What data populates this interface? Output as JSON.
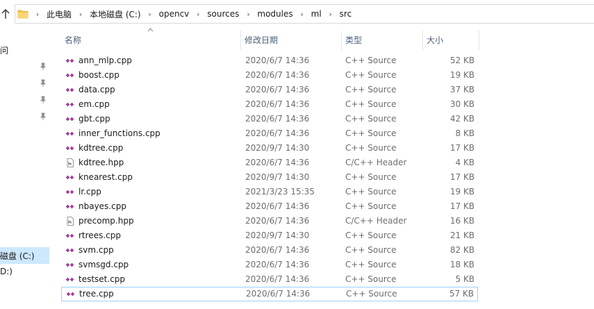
{
  "address": {
    "crumbs": [
      "此电脑",
      "本地磁盘 (C:)",
      "opencv",
      "sources",
      "modules",
      "ml",
      "src"
    ],
    "separator": "›"
  },
  "nav": {
    "partial_top": "问",
    "drive_c": "磁盘 (C:)",
    "drive_d": "D:)"
  },
  "columns": {
    "name": "名称",
    "date": "修改日期",
    "type": "类型",
    "size": "大小"
  },
  "files": [
    {
      "name": "ann_mlp.cpp",
      "date": "2020/6/7 14:36",
      "type": "C++ Source",
      "size": "52 KB",
      "icon": "cpp-file-icon"
    },
    {
      "name": "boost.cpp",
      "date": "2020/6/7 14:36",
      "type": "C++ Source",
      "size": "19 KB",
      "icon": "cpp-file-icon"
    },
    {
      "name": "data.cpp",
      "date": "2020/6/7 14:36",
      "type": "C++ Source",
      "size": "37 KB",
      "icon": "cpp-file-icon"
    },
    {
      "name": "em.cpp",
      "date": "2020/6/7 14:36",
      "type": "C++ Source",
      "size": "30 KB",
      "icon": "cpp-file-icon"
    },
    {
      "name": "gbt.cpp",
      "date": "2020/6/7 14:36",
      "type": "C++ Source",
      "size": "42 KB",
      "icon": "cpp-file-icon"
    },
    {
      "name": "inner_functions.cpp",
      "date": "2020/6/7 14:36",
      "type": "C++ Source",
      "size": "8 KB",
      "icon": "cpp-file-icon"
    },
    {
      "name": "kdtree.cpp",
      "date": "2020/9/7 14:30",
      "type": "C++ Source",
      "size": "17 KB",
      "icon": "cpp-file-icon"
    },
    {
      "name": "kdtree.hpp",
      "date": "2020/6/7 14:36",
      "type": "C/C++ Header",
      "size": "4 KB",
      "icon": "header-file-icon"
    },
    {
      "name": "knearest.cpp",
      "date": "2020/9/7 14:30",
      "type": "C++ Source",
      "size": "17 KB",
      "icon": "cpp-file-icon"
    },
    {
      "name": "lr.cpp",
      "date": "2021/3/23 15:35",
      "type": "C++ Source",
      "size": "19 KB",
      "icon": "cpp-file-icon"
    },
    {
      "name": "nbayes.cpp",
      "date": "2020/6/7 14:36",
      "type": "C++ Source",
      "size": "17 KB",
      "icon": "cpp-file-icon"
    },
    {
      "name": "precomp.hpp",
      "date": "2020/6/7 14:36",
      "type": "C/C++ Header",
      "size": "16 KB",
      "icon": "header-file-icon"
    },
    {
      "name": "rtrees.cpp",
      "date": "2020/9/7 14:30",
      "type": "C++ Source",
      "size": "21 KB",
      "icon": "cpp-file-icon"
    },
    {
      "name": "svm.cpp",
      "date": "2020/6/7 14:36",
      "type": "C++ Source",
      "size": "82 KB",
      "icon": "cpp-file-icon"
    },
    {
      "name": "svmsgd.cpp",
      "date": "2020/6/7 14:36",
      "type": "C++ Source",
      "size": "18 KB",
      "icon": "cpp-file-icon"
    },
    {
      "name": "testset.cpp",
      "date": "2020/6/7 14:36",
      "type": "C++ Source",
      "size": "5 KB",
      "icon": "cpp-file-icon"
    },
    {
      "name": "tree.cpp",
      "date": "2020/6/7 14:36",
      "type": "C++ Source",
      "size": "57 KB",
      "icon": "cpp-file-icon",
      "selected": true
    }
  ],
  "colors": {
    "cpp_icon": "#9b2a8e",
    "header_text": "#4c607a",
    "selection_border": "#99d1ff",
    "nav_selection": "#cce8ff",
    "folder": "#f2c94c"
  }
}
